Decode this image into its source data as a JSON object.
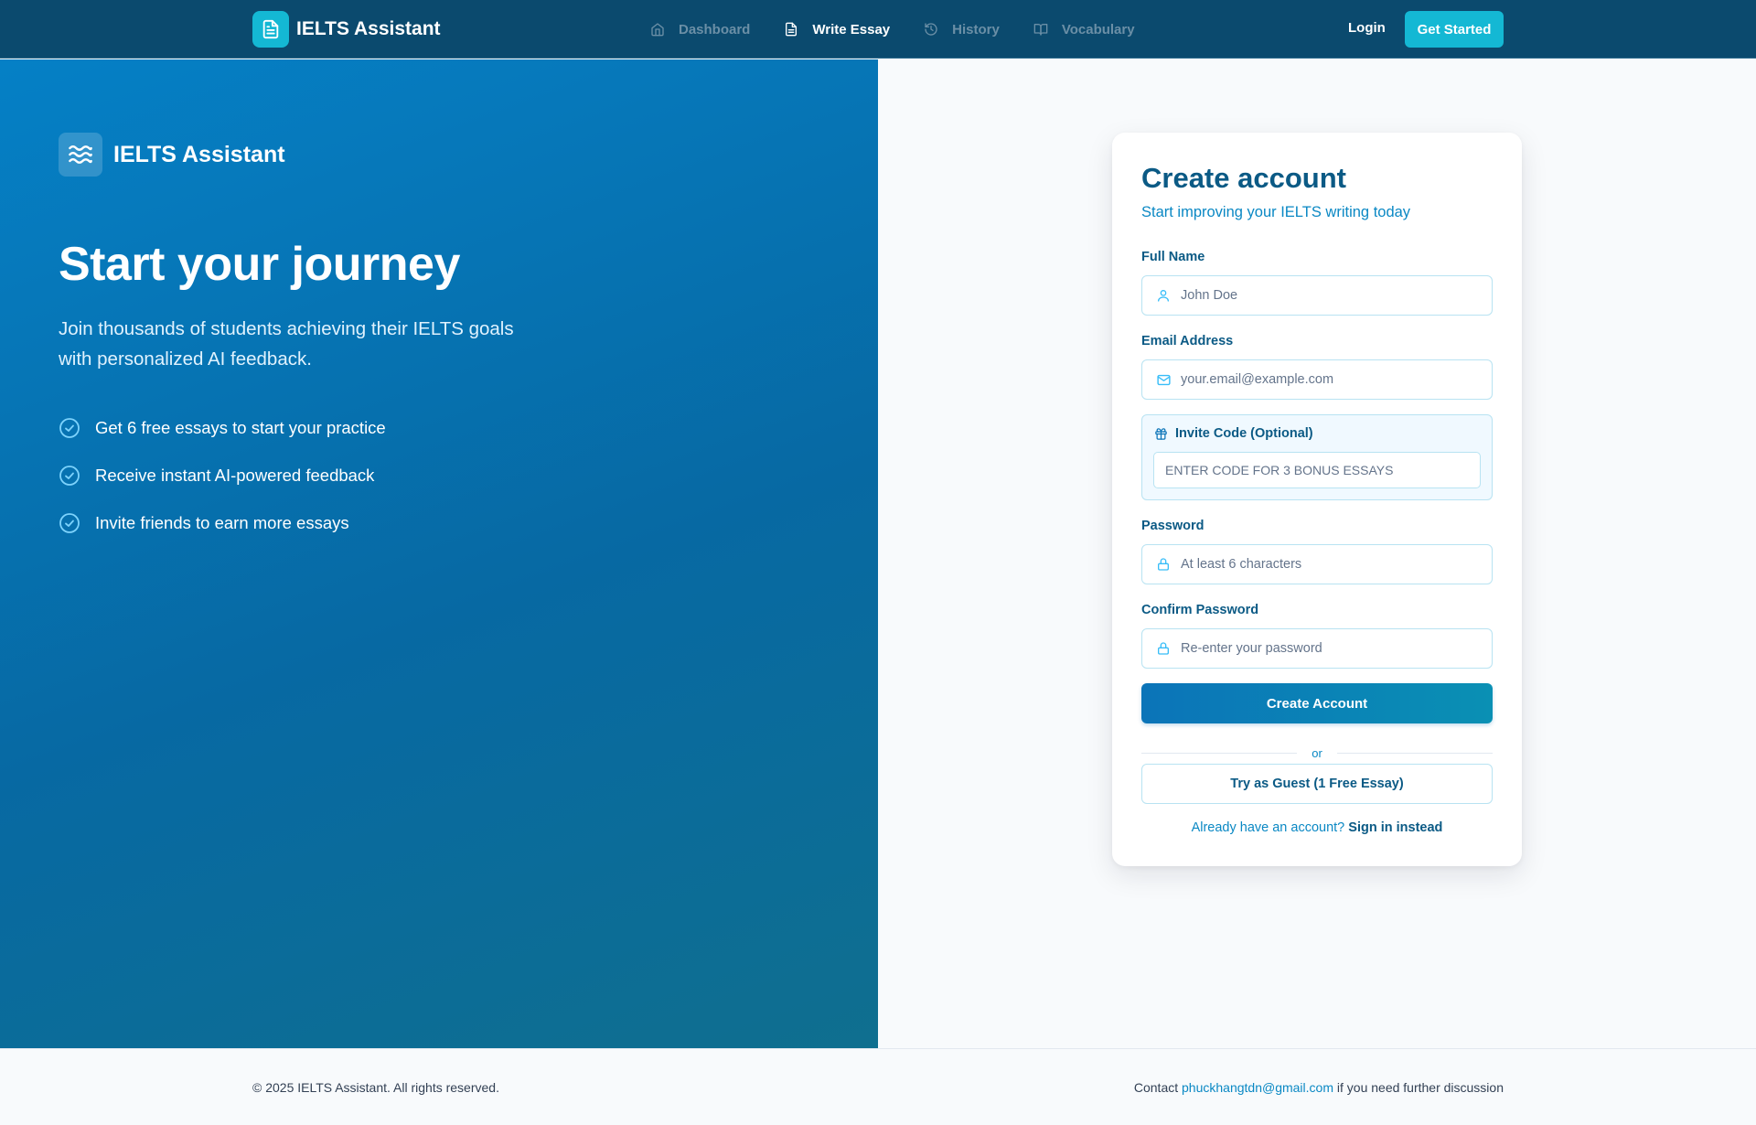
{
  "nav": {
    "brand": "IELTS Assistant",
    "links": [
      {
        "label": "Dashboard",
        "icon": "home-icon",
        "active": false
      },
      {
        "label": "Write Essay",
        "icon": "document-icon",
        "active": true
      },
      {
        "label": "History",
        "icon": "history-icon",
        "active": false
      },
      {
        "label": "Vocabulary",
        "icon": "book-icon",
        "active": false
      }
    ],
    "login": "Login",
    "get_started": "Get Started"
  },
  "hero": {
    "brand": "IELTS Assistant",
    "title": "Start your journey",
    "subtitle": "Join thousands of students achieving their IELTS goals with personalized AI feedback.",
    "features": [
      "Get 6 free essays to start your practice",
      "Receive instant AI-powered feedback",
      "Invite friends to earn more essays"
    ]
  },
  "form": {
    "title": "Create account",
    "subtitle": "Start improving your IELTS writing today",
    "full_name": {
      "label": "Full Name",
      "placeholder": "John Doe",
      "value": ""
    },
    "email": {
      "label": "Email Address",
      "placeholder": "your.email@example.com",
      "value": ""
    },
    "invite": {
      "label": "Invite Code (Optional)",
      "placeholder": "ENTER CODE FOR 3 BONUS ESSAYS",
      "value": ""
    },
    "password": {
      "label": "Password",
      "placeholder": "At least 6 characters",
      "value": ""
    },
    "confirm_password": {
      "label": "Confirm Password",
      "placeholder": "Re-enter your password",
      "value": ""
    },
    "submit": "Create Account",
    "divider": "or",
    "guest": "Try as Guest (1 Free Essay)",
    "signin_prompt": "Already have an account?",
    "signin_link": "Sign in instead"
  },
  "footer": {
    "copyright": "© 2025 IELTS Assistant. All rights reserved.",
    "contact_prefix": "Contact",
    "contact_email": "phuckhangtdn@gmail.com",
    "contact_suffix": "if you need further discussion"
  },
  "colors": {
    "nav_bg": "#0b4a6e",
    "accent": "#14b8d4",
    "primary": "#0b74b8",
    "hero_start": "#0580c6",
    "hero_end": "#0f6f8f"
  }
}
